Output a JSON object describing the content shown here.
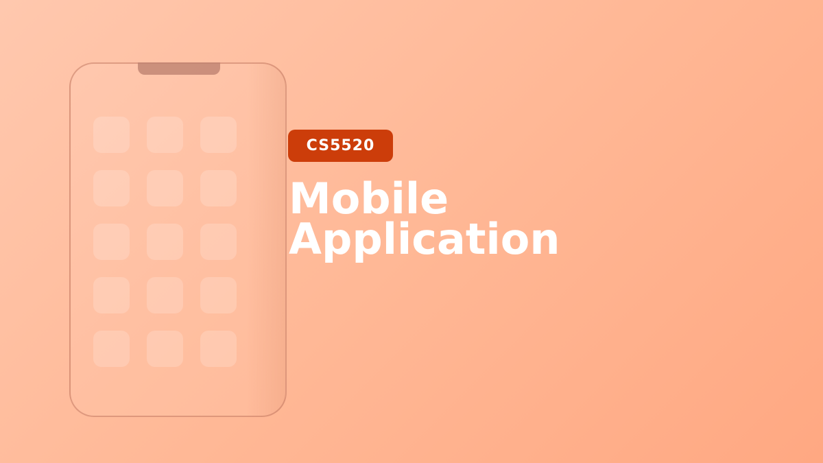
{
  "slide": {
    "badge": "CS5520",
    "title_line1": "Mobile",
    "title_line2": "Application"
  },
  "illustration": {
    "icon": "smartphone-home-screen-icon",
    "app_icon_rows": 5,
    "app_icon_columns": 3
  },
  "colors": {
    "background_start": "#ffc8ae",
    "background_end": "#ffa882",
    "badge": "#cc3d0a",
    "title_text": "#ffffff"
  }
}
